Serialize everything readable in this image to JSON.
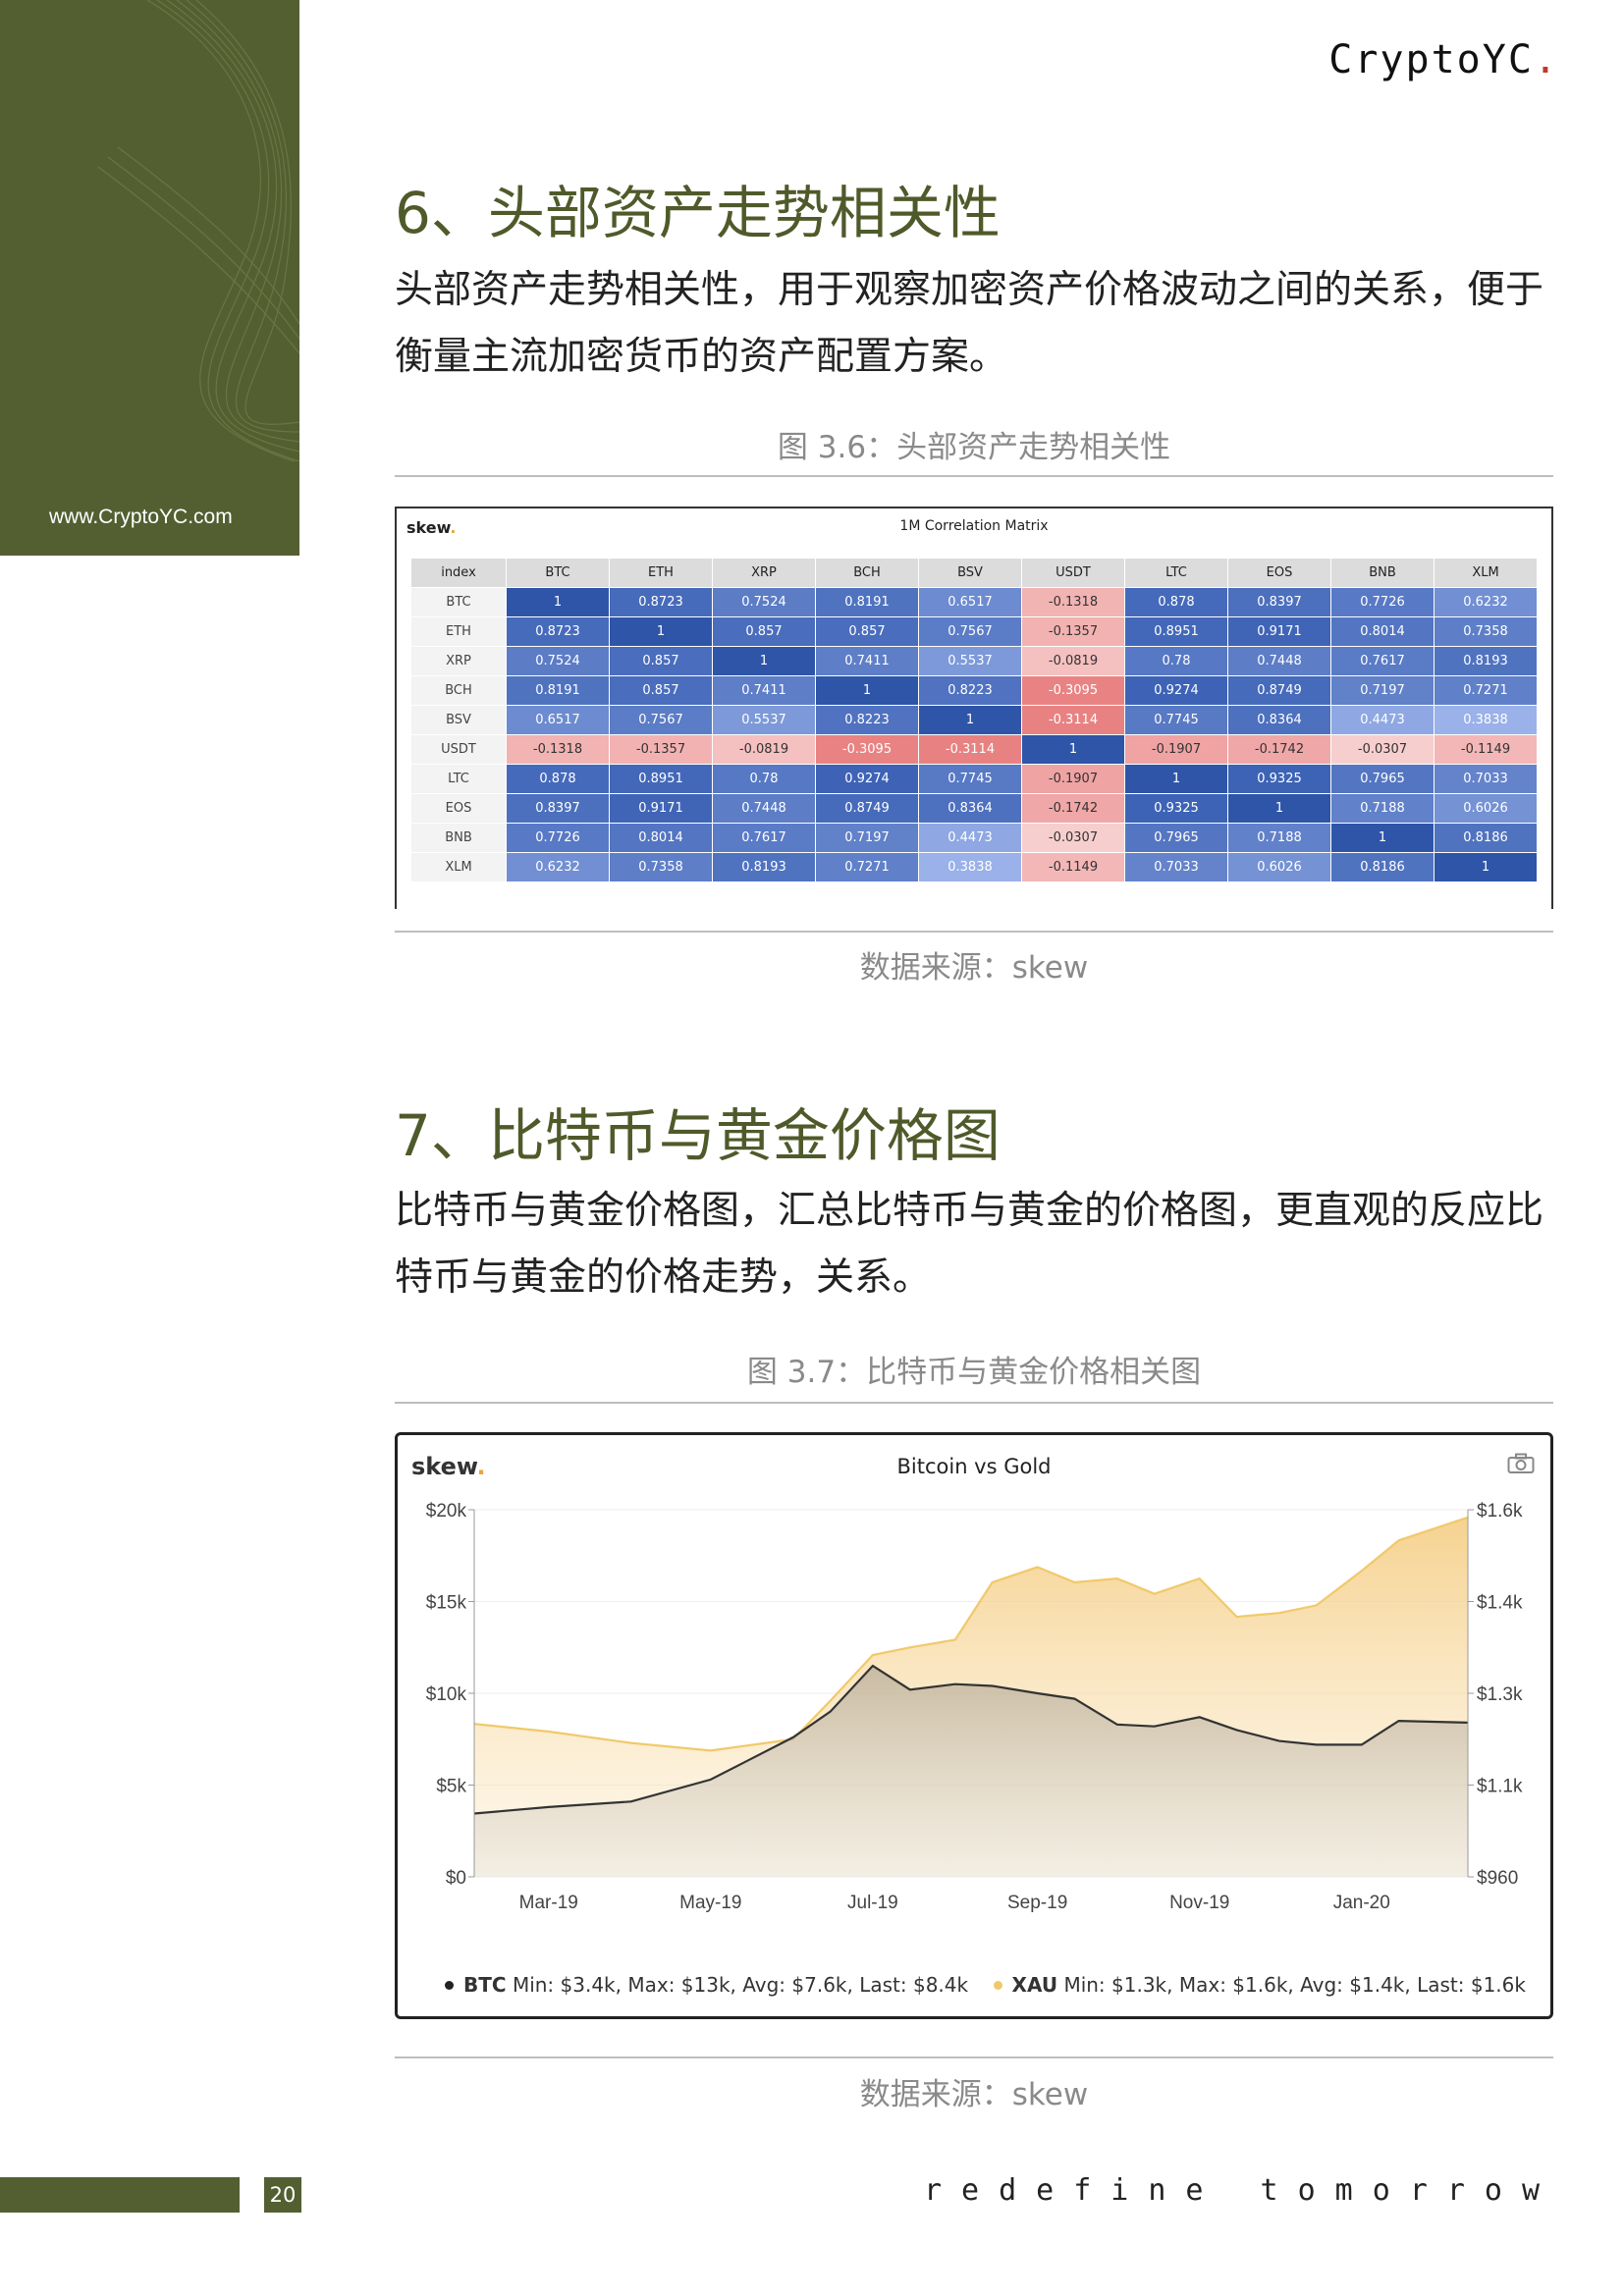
{
  "brand": {
    "name": "CryptoYC",
    "dot": "."
  },
  "sidebar": {
    "url": "www.CryptoYC.com"
  },
  "section6": {
    "heading": "6、头部资产走势相关性",
    "paragraph_lines": [
      "头部资产走势相关性，用于观察加密资产价格波动之间的关系，便于",
      "衡量主流加密货币的资产配置方案。"
    ],
    "figure_caption": "图 3.6：头部资产走势相关性",
    "source": "数据来源：skew"
  },
  "matrix": {
    "logo": "skew",
    "title": "1M Correlation Matrix",
    "header_index": "index",
    "assets": [
      "BTC",
      "ETH",
      "XRP",
      "BCH",
      "BSV",
      "USDT",
      "LTC",
      "EOS",
      "BNB",
      "XLM"
    ],
    "rows": [
      [
        "1",
        "0.8723",
        "0.7524",
        "0.8191",
        "0.6517",
        "-0.1318",
        "0.878",
        "0.8397",
        "0.7726",
        "0.6232"
      ],
      [
        "0.8723",
        "1",
        "0.857",
        "0.857",
        "0.7567",
        "-0.1357",
        "0.8951",
        "0.9171",
        "0.8014",
        "0.7358"
      ],
      [
        "0.7524",
        "0.857",
        "1",
        "0.7411",
        "0.5537",
        "-0.0819",
        "0.78",
        "0.7448",
        "0.7617",
        "0.8193"
      ],
      [
        "0.8191",
        "0.857",
        "0.7411",
        "1",
        "0.8223",
        "-0.3095",
        "0.9274",
        "0.8749",
        "0.7197",
        "0.7271"
      ],
      [
        "0.6517",
        "0.7567",
        "0.5537",
        "0.8223",
        "1",
        "-0.3114",
        "0.7745",
        "0.8364",
        "0.4473",
        "0.3838"
      ],
      [
        "-0.1318",
        "-0.1357",
        "-0.0819",
        "-0.3095",
        "-0.3114",
        "1",
        "-0.1907",
        "-0.1742",
        "-0.0307",
        "-0.1149"
      ],
      [
        "0.878",
        "0.8951",
        "0.78",
        "0.9274",
        "0.7745",
        "-0.1907",
        "1",
        "0.9325",
        "0.7965",
        "0.7033"
      ],
      [
        "0.8397",
        "0.9171",
        "0.7448",
        "0.8749",
        "0.8364",
        "-0.1742",
        "0.9325",
        "1",
        "0.7188",
        "0.6026"
      ],
      [
        "0.7726",
        "0.8014",
        "0.7617",
        "0.7197",
        "0.4473",
        "-0.0307",
        "0.7965",
        "0.7188",
        "1",
        "0.8186"
      ],
      [
        "0.6232",
        "0.7358",
        "0.8193",
        "0.7271",
        "0.3838",
        "-0.1149",
        "0.7033",
        "0.6026",
        "0.8186",
        "1"
      ]
    ]
  },
  "section7": {
    "heading": "7、比特币与黄金价格图",
    "paragraph_lines": [
      "比特币与黄金价格图，汇总比特币与黄金的价格图，更直观的反应比",
      "特币与黄金的价格走势，关系。"
    ],
    "figure_caption": "图 3.7：比特币与黄金价格相关图",
    "source": "数据来源：skew"
  },
  "chart_data": {
    "type": "area",
    "logo": "skew",
    "title": "Bitcoin vs Gold",
    "x": [
      "2019-02-01",
      "2019-03-01",
      "2019-04-01",
      "2019-05-01",
      "2019-06-01",
      "2019-06-15",
      "2019-07-01",
      "2019-07-15",
      "2019-08-01",
      "2019-08-15",
      "2019-09-01",
      "2019-09-15",
      "2019-10-01",
      "2019-10-15",
      "2019-11-01",
      "2019-11-15",
      "2019-12-01",
      "2019-12-15",
      "2020-01-01",
      "2020-01-15",
      "2020-02-10"
    ],
    "x_ticks": [
      "Mar-19",
      "May-19",
      "Jul-19",
      "Sep-19",
      "Nov-19",
      "Jan-20"
    ],
    "y_left_ticks": [
      "$0",
      "$5k",
      "$10k",
      "$15k",
      "$20k"
    ],
    "y_left_range": [
      0,
      20000
    ],
    "y_right_ticks": [
      "$960",
      "$1.1k",
      "$1.3k",
      "$1.4k",
      "$1.6k"
    ],
    "y_right_range": [
      1120,
      1600
    ],
    "series": [
      {
        "name": "XAU",
        "axis": "right",
        "color": "#f0c96a",
        "values": [
          1320,
          1310,
          1295,
          1285,
          1300,
          1350,
          1410,
          1420,
          1430,
          1505,
          1525,
          1505,
          1510,
          1490,
          1510,
          1460,
          1465,
          1475,
          1520,
          1560,
          1590
        ]
      },
      {
        "name": "BTC",
        "axis": "left",
        "color": "#333333",
        "values": [
          3450,
          3800,
          4100,
          5300,
          7600,
          9000,
          11500,
          10200,
          10500,
          10400,
          10000,
          9700,
          8300,
          8200,
          8700,
          8000,
          7400,
          7200,
          7200,
          8500,
          8400
        ]
      }
    ],
    "legend": [
      {
        "key": "BTC",
        "color": "#222222",
        "text": "Min: $3.4k, Max: $13k, Avg: $7.6k, Last: $8.4k"
      },
      {
        "key": "XAU",
        "color": "#f0c96a",
        "text": "Min: $1.3k, Max: $1.6k, Avg: $1.4k, Last: $1.6k"
      }
    ]
  },
  "footer": {
    "page_number": "20",
    "tagline": "redefine tomorrow"
  }
}
